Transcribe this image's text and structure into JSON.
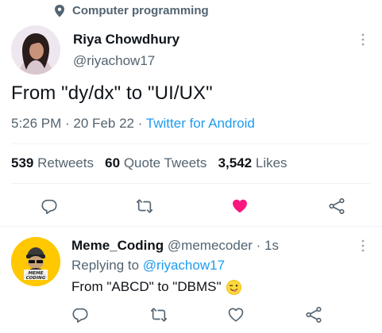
{
  "topic": {
    "label": "Computer programming",
    "icon": "location-pin-icon"
  },
  "tweet": {
    "author_name": "Riya Chowdhury",
    "author_handle": "@riyachow17",
    "text": "From \"dy/dx\" to \"UI/UX\"",
    "time": "5:26 PM",
    "sep1": " · ",
    "date": "20 Feb 22",
    "sep2": " · ",
    "source": "Twitter for Android",
    "stats": {
      "retweets_count": "539",
      "retweets_label": "Retweets",
      "quotes_count": "60",
      "quotes_label": "Quote Tweets",
      "likes_count": "3,542",
      "likes_label": "Likes"
    },
    "liked": true
  },
  "reply": {
    "name": "Meme_Coding",
    "handle": "@memecoder",
    "sep": " · ",
    "age": "1s",
    "replying_prefix": "Replying to ",
    "replying_handle": "@riyachow17",
    "text": "From \"ABCD\" to \"DBMS\"",
    "emoji": "wink-tongue-emoji",
    "avatar_text": "MEME CODING"
  },
  "colors": {
    "accent": "#1d9bf0",
    "like": "#f91880",
    "secondary_text": "#536471",
    "avatar_bg": "#ffc800"
  }
}
